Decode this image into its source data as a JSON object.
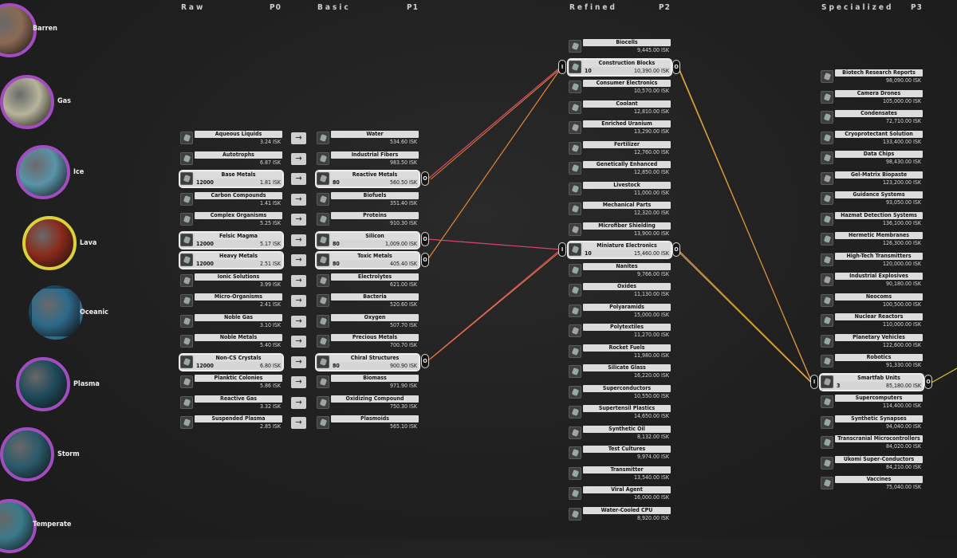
{
  "headers": {
    "raw": "Raw",
    "p0": "P0",
    "basic": "Basic",
    "p1": "P1",
    "refined": "Refined",
    "p2": "P2",
    "specialized": "Specialized",
    "p3": "P3"
  },
  "planets": [
    {
      "name": "Barren",
      "color": "#8a6a55"
    },
    {
      "name": "Gas",
      "color": "#b6b49a"
    },
    {
      "name": "Ice",
      "color": "#5a93a8"
    },
    {
      "name": "Lava",
      "color": "#8a2a1a"
    },
    {
      "name": "Oceanic",
      "color": "#2e6a8a"
    },
    {
      "name": "Plasma",
      "color": "#1e4a5a"
    },
    {
      "name": "Storm",
      "color": "#2a5a6a"
    },
    {
      "name": "Temperate",
      "color": "#3a7a8a"
    }
  ],
  "raw": [
    {
      "name": "Aqueous Liquids",
      "price": "3.24 ISK"
    },
    {
      "name": "Autotrophs",
      "price": "6.87 ISK"
    },
    {
      "name": "Base Metals",
      "price": "1.81 ISK",
      "qty": "12000",
      "selected": true
    },
    {
      "name": "Carbon Compounds",
      "price": "1.41 ISK"
    },
    {
      "name": "Complex Organisms",
      "price": "5.25 ISK"
    },
    {
      "name": "Felsic Magma",
      "price": "5.17 ISK",
      "qty": "12000",
      "selected": true
    },
    {
      "name": "Heavy Metals",
      "price": "2.51 ISK",
      "qty": "12000",
      "selected": true
    },
    {
      "name": "Ionic Solutions",
      "price": "3.99 ISK"
    },
    {
      "name": "Micro-Organisms",
      "price": "2.41 ISK"
    },
    {
      "name": "Noble Gas",
      "price": "3.10 ISK"
    },
    {
      "name": "Noble Metals",
      "price": "5.40 ISK"
    },
    {
      "name": "Non-CS Crystals",
      "price": "6.80 ISK",
      "qty": "12000",
      "selected": true
    },
    {
      "name": "Planktic Colonies",
      "price": "5.86 ISK"
    },
    {
      "name": "Reactive Gas",
      "price": "3.32 ISK"
    },
    {
      "name": "Suspended Plasma",
      "price": "2.85 ISK"
    }
  ],
  "basic": [
    {
      "name": "Water",
      "price": "534.60 ISK"
    },
    {
      "name": "Industrial Fibers",
      "price": "983.50 ISK"
    },
    {
      "name": "Reactive Metals",
      "price": "560.50 ISK",
      "qty": "80",
      "selected": true
    },
    {
      "name": "Biofuels",
      "price": "351.40 ISK"
    },
    {
      "name": "Proteins",
      "price": "910.30 ISK"
    },
    {
      "name": "Silicon",
      "price": "1,009.00 ISK",
      "qty": "80",
      "selected": true
    },
    {
      "name": "Toxic Metals",
      "price": "405.40 ISK",
      "qty": "80",
      "selected": true
    },
    {
      "name": "Electrolytes",
      "price": "621.00 ISK"
    },
    {
      "name": "Bacteria",
      "price": "520.60 ISK"
    },
    {
      "name": "Oxygen",
      "price": "507.70 ISK"
    },
    {
      "name": "Precious Metals",
      "price": "700.70 ISK"
    },
    {
      "name": "Chiral Structures",
      "price": "900.90 ISK",
      "qty": "80",
      "selected": true
    },
    {
      "name": "Biomass",
      "price": "971.90 ISK"
    },
    {
      "name": "Oxidizing Compound",
      "price": "750.30 ISK"
    },
    {
      "name": "Plasmoids",
      "price": "565.10 ISK"
    }
  ],
  "refined": [
    {
      "name": "Biocells",
      "price": "9,445.00 ISK"
    },
    {
      "name": "Construction Blocks",
      "price": "10,390.00 ISK",
      "qty": "10",
      "selected": true
    },
    {
      "name": "Consumer Electronics",
      "price": "10,570.00 ISK"
    },
    {
      "name": "Coolant",
      "price": "12,810.00 ISK"
    },
    {
      "name": "Enriched Uranium",
      "price": "13,290.00 ISK"
    },
    {
      "name": "Fertilizer",
      "price": "12,760.00 ISK"
    },
    {
      "name": "Genetically Enhanced",
      "price": "12,850.00 ISK"
    },
    {
      "name": "Livestock",
      "price": "11,000.00 ISK"
    },
    {
      "name": "Mechanical Parts",
      "price": "12,320.00 ISK"
    },
    {
      "name": "Microfiber Shielding",
      "price": "13,900.00 ISK"
    },
    {
      "name": "Miniature Electronics",
      "price": "15,460.00 ISK",
      "qty": "10",
      "selected": true
    },
    {
      "name": "Nanites",
      "price": "9,766.00 ISK"
    },
    {
      "name": "Oxides",
      "price": "11,130.00 ISK"
    },
    {
      "name": "Polyaramids",
      "price": "15,000.00 ISK"
    },
    {
      "name": "Polytextiles",
      "price": "11,270.00 ISK"
    },
    {
      "name": "Rocket Fuels",
      "price": "11,980.00 ISK"
    },
    {
      "name": "Silicate Glass",
      "price": "16,220.00 ISK"
    },
    {
      "name": "Superconductors",
      "price": "10,550.00 ISK"
    },
    {
      "name": "Supertensil Plastics",
      "price": "14,650.00 ISK"
    },
    {
      "name": "Synthetic Oil",
      "price": "8,132.00 ISK"
    },
    {
      "name": "Test Cultures",
      "price": "9,974.00 ISK"
    },
    {
      "name": "Transmitter",
      "price": "13,540.00 ISK"
    },
    {
      "name": "Viral Agent",
      "price": "16,000.00 ISK"
    },
    {
      "name": "Water-Cooled CPU",
      "price": "8,920.00 ISK"
    }
  ],
  "specialized": [
    {
      "name": "Biotech Research Reports",
      "price": "98,090.00 ISK"
    },
    {
      "name": "Camera Drones",
      "price": "105,000.00 ISK"
    },
    {
      "name": "Condensates",
      "price": "72,710.00 ISK"
    },
    {
      "name": "Cryoprotectant Solution",
      "price": "133,400.00 ISK"
    },
    {
      "name": "Data Chips",
      "price": "98,430.00 ISK"
    },
    {
      "name": "Gel-Matrix Biopaste",
      "price": "123,200.00 ISK"
    },
    {
      "name": "Guidance Systems",
      "price": "93,050.00 ISK"
    },
    {
      "name": "Hazmat Detection Systems",
      "price": "136,100.00 ISK"
    },
    {
      "name": "Hermetic Membranes",
      "price": "126,300.00 ISK"
    },
    {
      "name": "High-Tech Transmitters",
      "price": "120,000.00 ISK"
    },
    {
      "name": "Industrial Explosives",
      "price": "90,180.00 ISK"
    },
    {
      "name": "Neocoms",
      "price": "100,500.00 ISK"
    },
    {
      "name": "Nuclear Reactors",
      "price": "110,000.00 ISK"
    },
    {
      "name": "Planetary Vehicles",
      "price": "122,600.00 ISK"
    },
    {
      "name": "Robotics",
      "price": "91,330.00 ISK"
    },
    {
      "name": "Smartfab Units",
      "price": "85,180.00 ISK",
      "qty": "3",
      "selected": true
    },
    {
      "name": "Supercomputers",
      "price": "114,400.00 ISK"
    },
    {
      "name": "Synthetic Synapses",
      "price": "94,040.00 ISK"
    },
    {
      "name": "Transcranial Microcontrollers",
      "price": "84,020.00 ISK"
    },
    {
      "name": "Ukomi Super-Conductors",
      "price": "84,210.00 ISK"
    },
    {
      "name": "Vaccines",
      "price": "75,040.00 ISK"
    }
  ],
  "arrow_glyph": "→",
  "pill_input": "I",
  "pill_output": "O",
  "colors": {
    "link_pink": "#d9456d",
    "link_orange": "#e2863a",
    "link_yellow": "#d8c43a",
    "planet_ring": "#a24dbf",
    "lava_ring": "#d9d23a"
  }
}
